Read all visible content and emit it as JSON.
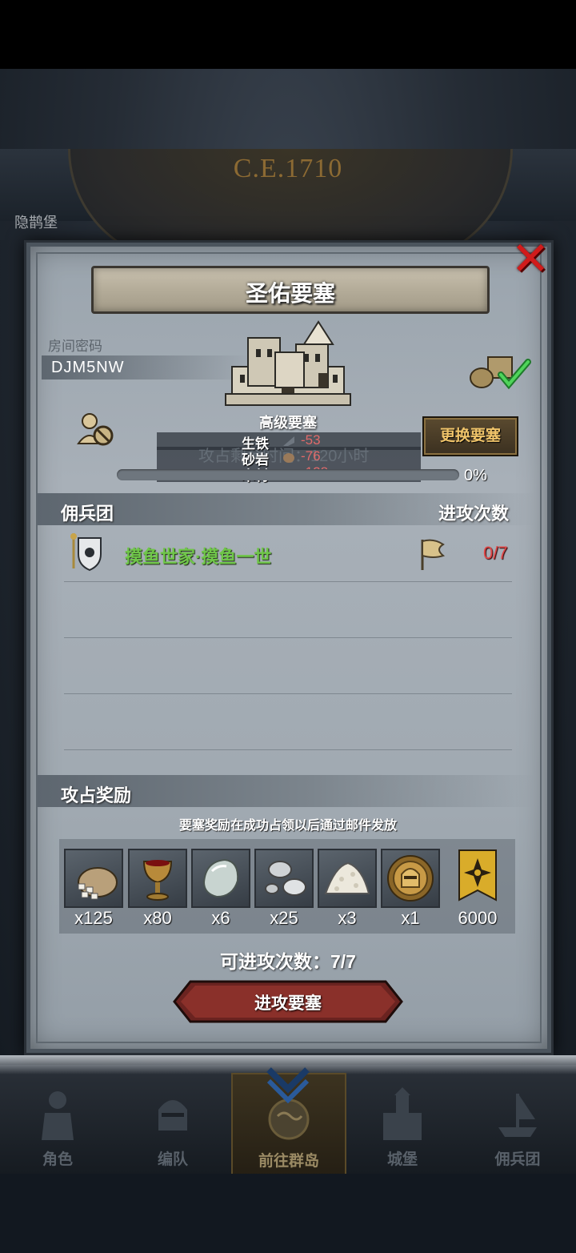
{
  "era": "C.E.1710",
  "background_place": "隐鹊堡",
  "dialog": {
    "title": "圣佑要塞",
    "room_code_label": "房间密码",
    "room_code": "DJM5NW",
    "fortress_level": "高级要塞",
    "resources": [
      {
        "name": "生铁",
        "value": "-53",
        "icon": "iron-icon"
      },
      {
        "name": "砂岩",
        "value": "-76",
        "icon": "sandstone-icon"
      },
      {
        "name": "木材",
        "value": "-128",
        "icon": "wood-icon"
      }
    ],
    "timer_text": "攻占剩余时间：120小时",
    "change_button": "更换要塞",
    "progress_percent": 0,
    "progress_label": "0%",
    "mercenary_header": "佣兵团",
    "attack_header": "进攻次数",
    "guild": {
      "name": "摸鱼世家·摸鱼一世",
      "attacks": "0/7",
      "icon": "guild-shield-icon"
    },
    "reward_header": "攻占奖励",
    "reward_note": "要塞奖励在成功占领以后通过邮件发放",
    "rewards": [
      {
        "icon": "sack-icon",
        "qty": "x125"
      },
      {
        "icon": "goblet-icon",
        "qty": "x80"
      },
      {
        "icon": "gem-icon",
        "qty": "x6"
      },
      {
        "icon": "silver-ore-icon",
        "qty": "x25"
      },
      {
        "icon": "salt-pile-icon",
        "qty": "x3"
      },
      {
        "icon": "knight-medal-icon",
        "qty": "x1"
      },
      {
        "icon": "banner-icon",
        "qty": "6000"
      }
    ],
    "attempts_text": "可进攻次数：7/7",
    "attack_button": "进攻要塞"
  },
  "nav": [
    {
      "label": "角色",
      "icon": "knight-icon"
    },
    {
      "label": "编队",
      "icon": "helmet-icon"
    },
    {
      "label": "前往群岛",
      "icon": "globe-icon",
      "active": true
    },
    {
      "label": "城堡",
      "icon": "castle-icon"
    },
    {
      "label": "佣兵团",
      "icon": "ship-icon"
    }
  ],
  "colors": {
    "accent_gold": "#f0c46a",
    "guild_green": "#6fc649",
    "negative_red": "#e06a6a"
  }
}
